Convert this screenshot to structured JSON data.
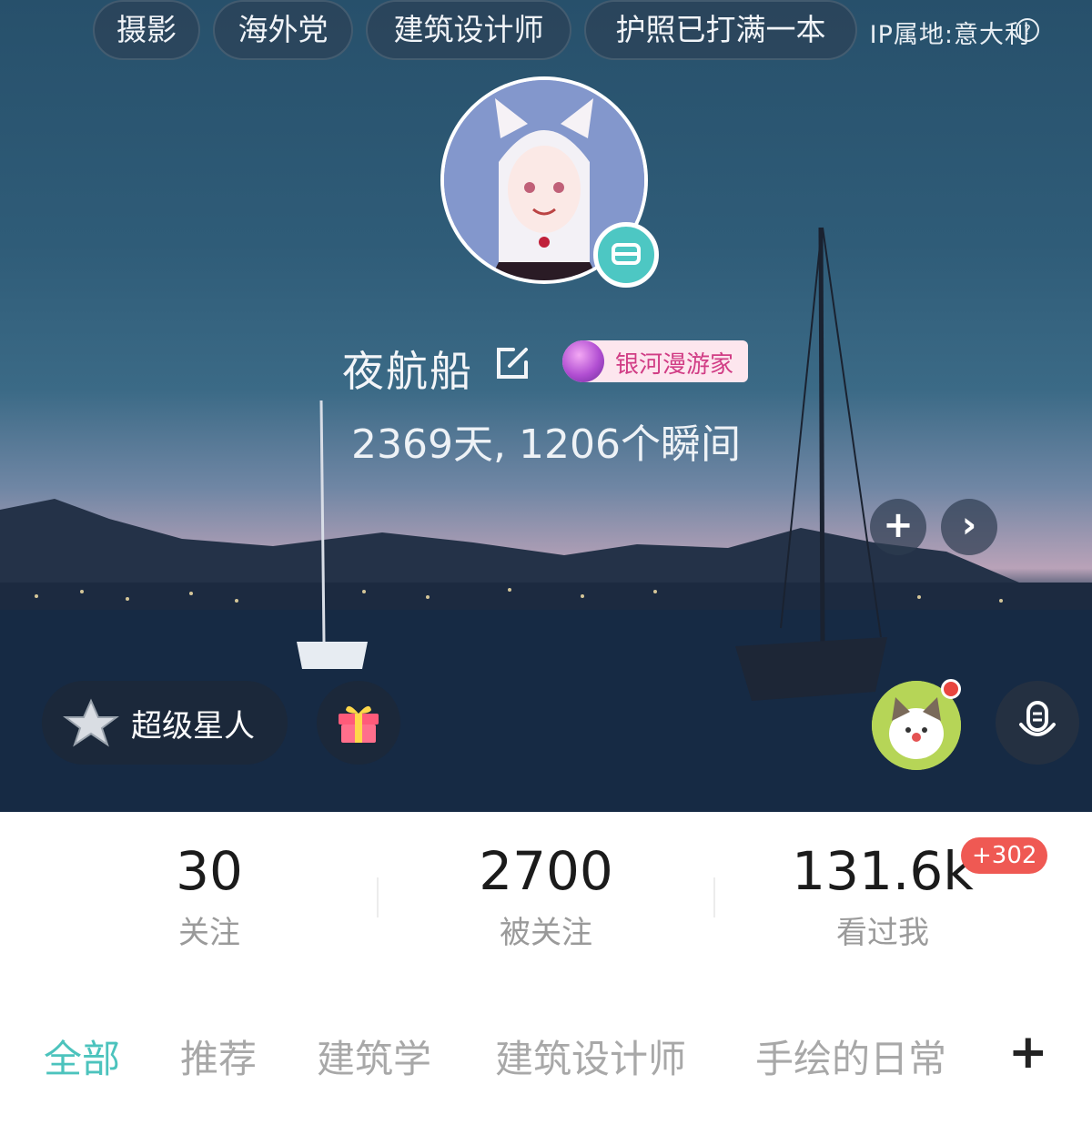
{
  "header": {
    "ip_location": "IP属地:意大利",
    "help_glyph": "?"
  },
  "profile": {
    "username": "夜航船",
    "level_badge": "银河漫游家",
    "stats_line": "2369天, 1206个瞬间",
    "tags": [
      "摄影",
      "海外党",
      "建筑设计师",
      "护照已打满一本"
    ],
    "add_tag_glyph": "+",
    "more_tags_glyph": "›"
  },
  "actions": {
    "super_star_label": "超级星人"
  },
  "counts": [
    {
      "value": "30",
      "label": "关注"
    },
    {
      "value": "2700",
      "label": "被关注"
    },
    {
      "value": "131.6k",
      "label": "看过我",
      "delta": "+302"
    }
  ],
  "tabs": {
    "items": [
      "全部",
      "推荐",
      "建筑学",
      "建筑设计师",
      "手绘的日常"
    ],
    "active_index": 0,
    "add_glyph": "+"
  },
  "icons": [
    "question-icon",
    "edit-icon",
    "galaxy-badge-icon",
    "plus-icon",
    "chevron-right-icon",
    "super-star-icon",
    "gift-icon",
    "mic-icon",
    "avatar-frame-icon"
  ],
  "colors": {
    "accent": "#4cc3bd",
    "badge_text": "#d13d85",
    "delta_bg": "#ef5953",
    "muted": "#a8a8a8"
  }
}
